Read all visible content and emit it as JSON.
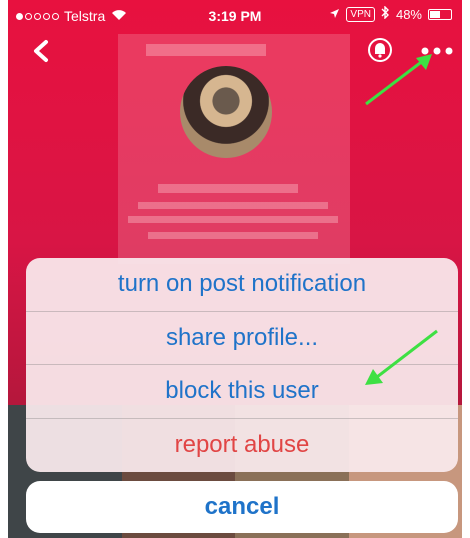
{
  "status_bar": {
    "carrier": "Telstra",
    "time": "3:19 PM",
    "vpn": "VPN",
    "battery": "48%",
    "battery_level": 0.48,
    "signal_dots_filled": 1,
    "signal_dots_total": 5
  },
  "nav": {
    "back_icon": "chevron-left-icon",
    "bell_icon": "bell-icon",
    "more_icon": "ellipsis-icon"
  },
  "colors": {
    "background": "#e8113f",
    "action_text": "#1f73c9",
    "destructive_text": "#e14545",
    "annotation_arrow": "#3ee043"
  },
  "action_sheet": {
    "items": [
      {
        "label": "turn on post notification",
        "style": "default"
      },
      {
        "label": "share profile...",
        "style": "default"
      },
      {
        "label": "block this user",
        "style": "default"
      },
      {
        "label": "report abuse",
        "style": "destructive"
      }
    ],
    "cancel_label": "cancel"
  }
}
